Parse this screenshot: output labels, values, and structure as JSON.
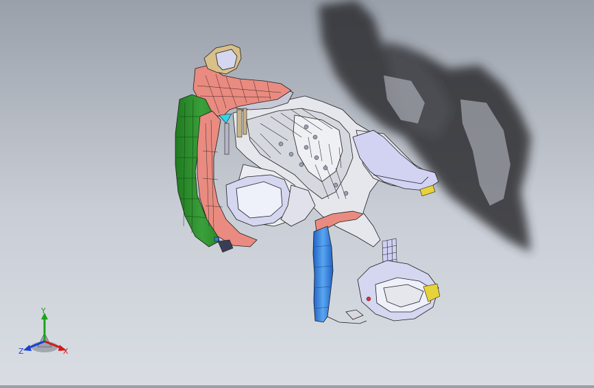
{
  "viewport": {
    "background_top": "#9aa0aa",
    "background_bottom": "#d9dde3",
    "model_colors": {
      "salmon": "#e98b80",
      "green": "#2e8b2e",
      "light_gray": "#e6e7ec",
      "lavender": "#cfd0f2",
      "blue": "#2f7fd6",
      "yellow": "#e6d23a",
      "tan": "#d9c089",
      "cyan": "#35d3e8",
      "edge": "#1c1c1c",
      "shadow": "#2e2f33"
    }
  },
  "triad": {
    "x_label": "X",
    "y_label": "Y",
    "z_label": "Z",
    "x_color": "#d21a1a",
    "y_color": "#1aa31a",
    "z_color": "#1a3fd2"
  }
}
